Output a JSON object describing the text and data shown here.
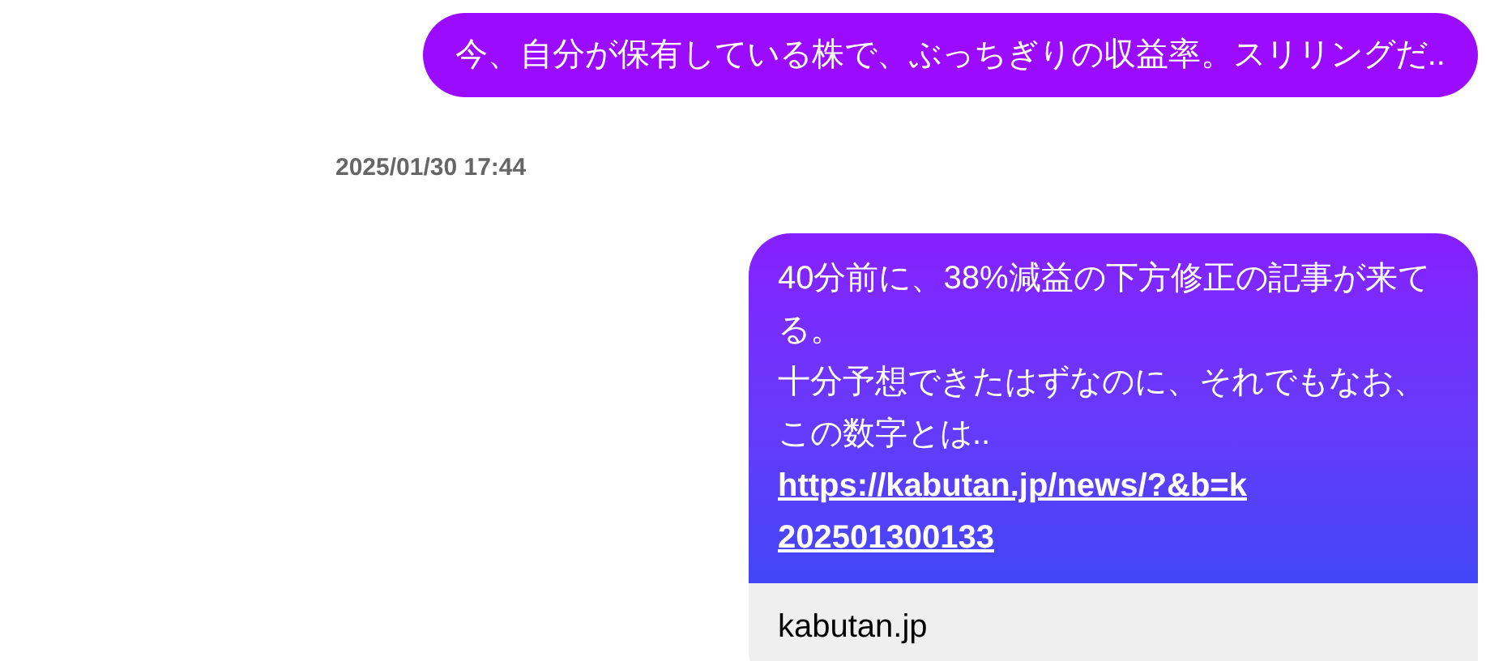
{
  "messages": [
    {
      "kind": "text",
      "text": "今、自分が保有している株で、ぶっちぎりの収益率。スリリングだ.."
    },
    {
      "kind": "timestamp",
      "text": "2025/01/30 17:44"
    },
    {
      "kind": "link",
      "paragraphs": [
        "40分前に、38%減益の下方修正の記事が来てる。",
        "十分予想できたはずなのに、それでもなお、この数字とは.."
      ],
      "link": "https://kabutan.jp/news/?&b=k202501300133",
      "preview": {
        "domain": "kabutan.jp"
      }
    }
  ]
}
